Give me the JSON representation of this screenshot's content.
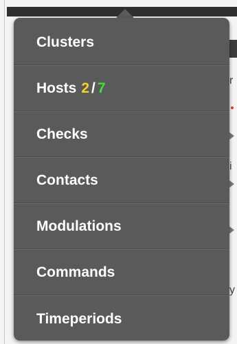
{
  "menu": {
    "items": [
      {
        "label": "Clusters"
      },
      {
        "label": "Hosts",
        "count_problem": "2",
        "separator": "/",
        "count_total": "7"
      },
      {
        "label": "Checks"
      },
      {
        "label": "Contacts"
      },
      {
        "label": "Modulations"
      },
      {
        "label": "Commands"
      },
      {
        "label": "Timeperiods"
      }
    ]
  },
  "background": {
    "fragments": [
      "r",
      "i",
      "y"
    ]
  },
  "colors": {
    "menu_bg": "#5a5a5a",
    "problem_count": "#f7d02c",
    "total_count": "#3ee03e",
    "top_bar": "#2f2f2f"
  }
}
